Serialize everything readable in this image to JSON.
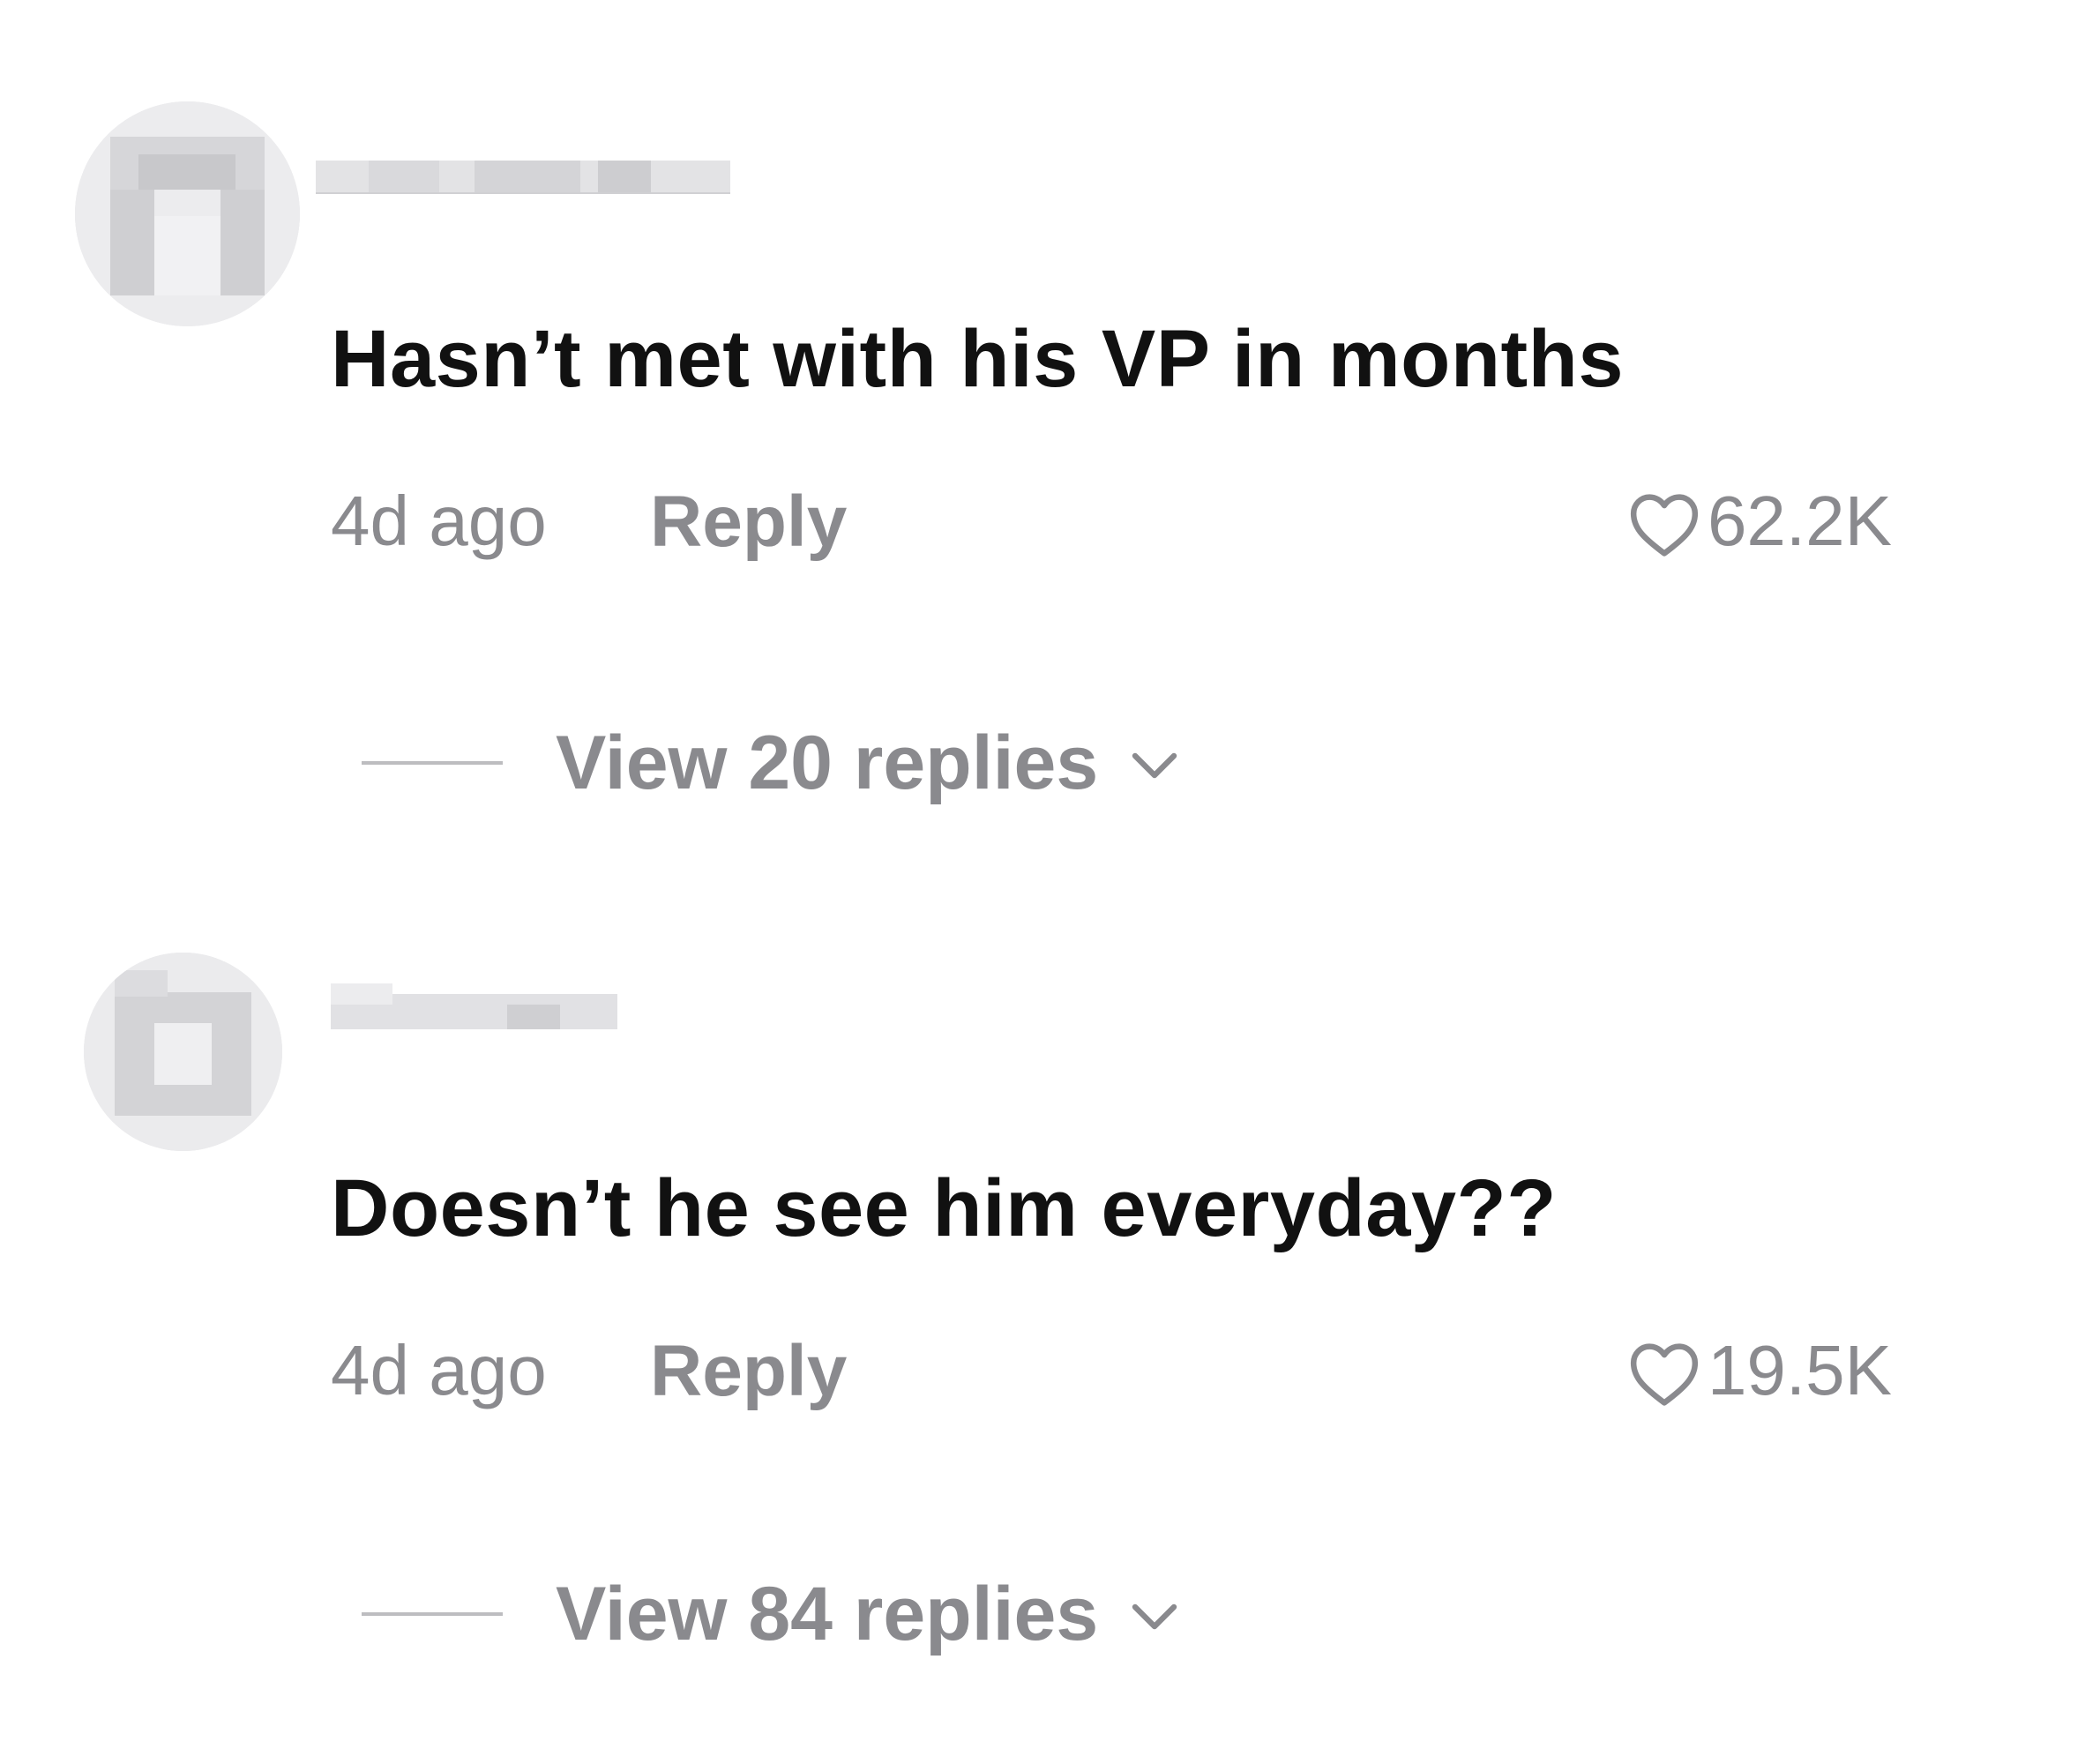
{
  "comments": [
    {
      "text": "Hasn’t met with his VP in months",
      "time": "4d ago",
      "reply_label": "Reply",
      "likes": "62.2K",
      "view_replies_label": "View 20 replies"
    },
    {
      "text": "Doesn’t he see him everyday??",
      "time": "4d ago",
      "reply_label": "Reply",
      "likes": "19.5K",
      "view_replies_label": "View 84 replies"
    }
  ],
  "icons": {
    "like": "heart-outline-icon",
    "expand": "chevron-down-icon"
  },
  "colors": {
    "text_primary": "#111111",
    "text_secondary": "#8a8a8e",
    "divider": "#bdbdc0",
    "background": "#ffffff"
  }
}
